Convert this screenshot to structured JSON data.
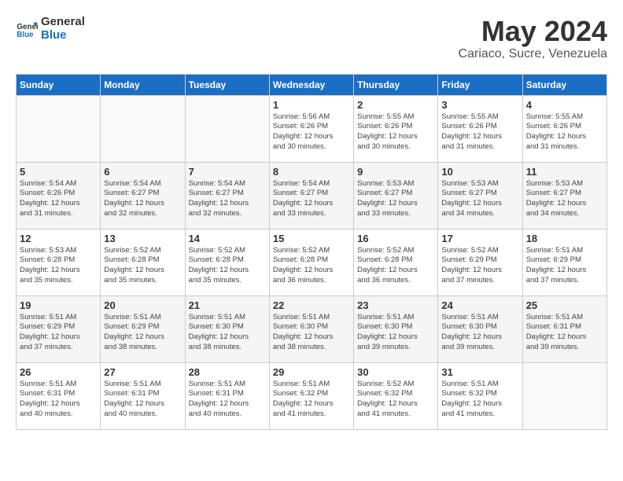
{
  "header": {
    "logo_line1": "General",
    "logo_line2": "Blue",
    "month": "May 2024",
    "location": "Cariaco, Sucre, Venezuela"
  },
  "weekdays": [
    "Sunday",
    "Monday",
    "Tuesday",
    "Wednesday",
    "Thursday",
    "Friday",
    "Saturday"
  ],
  "weeks": [
    [
      {
        "day": "",
        "info": ""
      },
      {
        "day": "",
        "info": ""
      },
      {
        "day": "",
        "info": ""
      },
      {
        "day": "1",
        "info": "Sunrise: 5:56 AM\nSunset: 6:26 PM\nDaylight: 12 hours\nand 30 minutes."
      },
      {
        "day": "2",
        "info": "Sunrise: 5:55 AM\nSunset: 6:26 PM\nDaylight: 12 hours\nand 30 minutes."
      },
      {
        "day": "3",
        "info": "Sunrise: 5:55 AM\nSunset: 6:26 PM\nDaylight: 12 hours\nand 31 minutes."
      },
      {
        "day": "4",
        "info": "Sunrise: 5:55 AM\nSunset: 6:26 PM\nDaylight: 12 hours\nand 31 minutes."
      }
    ],
    [
      {
        "day": "5",
        "info": "Sunrise: 5:54 AM\nSunset: 6:26 PM\nDaylight: 12 hours\nand 31 minutes."
      },
      {
        "day": "6",
        "info": "Sunrise: 5:54 AM\nSunset: 6:27 PM\nDaylight: 12 hours\nand 32 minutes."
      },
      {
        "day": "7",
        "info": "Sunrise: 5:54 AM\nSunset: 6:27 PM\nDaylight: 12 hours\nand 32 minutes."
      },
      {
        "day": "8",
        "info": "Sunrise: 5:54 AM\nSunset: 6:27 PM\nDaylight: 12 hours\nand 33 minutes."
      },
      {
        "day": "9",
        "info": "Sunrise: 5:53 AM\nSunset: 6:27 PM\nDaylight: 12 hours\nand 33 minutes."
      },
      {
        "day": "10",
        "info": "Sunrise: 5:53 AM\nSunset: 6:27 PM\nDaylight: 12 hours\nand 34 minutes."
      },
      {
        "day": "11",
        "info": "Sunrise: 5:53 AM\nSunset: 6:27 PM\nDaylight: 12 hours\nand 34 minutes."
      }
    ],
    [
      {
        "day": "12",
        "info": "Sunrise: 5:53 AM\nSunset: 6:28 PM\nDaylight: 12 hours\nand 35 minutes."
      },
      {
        "day": "13",
        "info": "Sunrise: 5:52 AM\nSunset: 6:28 PM\nDaylight: 12 hours\nand 35 minutes."
      },
      {
        "day": "14",
        "info": "Sunrise: 5:52 AM\nSunset: 6:28 PM\nDaylight: 12 hours\nand 35 minutes."
      },
      {
        "day": "15",
        "info": "Sunrise: 5:52 AM\nSunset: 6:28 PM\nDaylight: 12 hours\nand 36 minutes."
      },
      {
        "day": "16",
        "info": "Sunrise: 5:52 AM\nSunset: 6:28 PM\nDaylight: 12 hours\nand 36 minutes."
      },
      {
        "day": "17",
        "info": "Sunrise: 5:52 AM\nSunset: 6:29 PM\nDaylight: 12 hours\nand 37 minutes."
      },
      {
        "day": "18",
        "info": "Sunrise: 5:51 AM\nSunset: 6:29 PM\nDaylight: 12 hours\nand 37 minutes."
      }
    ],
    [
      {
        "day": "19",
        "info": "Sunrise: 5:51 AM\nSunset: 6:29 PM\nDaylight: 12 hours\nand 37 minutes."
      },
      {
        "day": "20",
        "info": "Sunrise: 5:51 AM\nSunset: 6:29 PM\nDaylight: 12 hours\nand 38 minutes."
      },
      {
        "day": "21",
        "info": "Sunrise: 5:51 AM\nSunset: 6:30 PM\nDaylight: 12 hours\nand 38 minutes."
      },
      {
        "day": "22",
        "info": "Sunrise: 5:51 AM\nSunset: 6:30 PM\nDaylight: 12 hours\nand 38 minutes."
      },
      {
        "day": "23",
        "info": "Sunrise: 5:51 AM\nSunset: 6:30 PM\nDaylight: 12 hours\nand 39 minutes."
      },
      {
        "day": "24",
        "info": "Sunrise: 5:51 AM\nSunset: 6:30 PM\nDaylight: 12 hours\nand 39 minutes."
      },
      {
        "day": "25",
        "info": "Sunrise: 5:51 AM\nSunset: 6:31 PM\nDaylight: 12 hours\nand 39 minutes."
      }
    ],
    [
      {
        "day": "26",
        "info": "Sunrise: 5:51 AM\nSunset: 6:31 PM\nDaylight: 12 hours\nand 40 minutes."
      },
      {
        "day": "27",
        "info": "Sunrise: 5:51 AM\nSunset: 6:31 PM\nDaylight: 12 hours\nand 40 minutes."
      },
      {
        "day": "28",
        "info": "Sunrise: 5:51 AM\nSunset: 6:31 PM\nDaylight: 12 hours\nand 40 minutes."
      },
      {
        "day": "29",
        "info": "Sunrise: 5:51 AM\nSunset: 6:32 PM\nDaylight: 12 hours\nand 41 minutes."
      },
      {
        "day": "30",
        "info": "Sunrise: 5:52 AM\nSunset: 6:32 PM\nDaylight: 12 hours\nand 41 minutes."
      },
      {
        "day": "31",
        "info": "Sunrise: 5:51 AM\nSunset: 6:32 PM\nDaylight: 12 hours\nand 41 minutes."
      },
      {
        "day": "",
        "info": ""
      }
    ]
  ]
}
